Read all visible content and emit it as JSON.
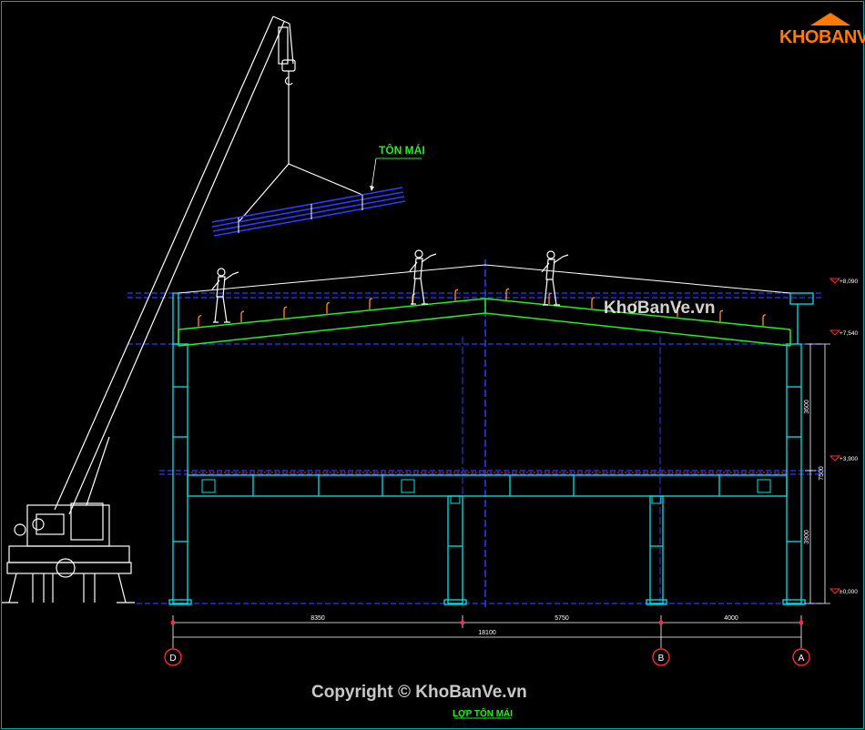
{
  "logo": {
    "brand": "KHOBANVE"
  },
  "watermark": "KhoBanVe.vn",
  "copyright": "Copyright © KhoBanVe.vn",
  "title": "LỢP TÔN MÁI",
  "callout_label": "TÔN MÁI",
  "levels": {
    "top": "+8,090",
    "eave": "+7,540",
    "mezzanine": "+3,900",
    "ground": "±0,000"
  },
  "vertical_dims": {
    "upper": "3600",
    "lower": "3900",
    "total": "7500"
  },
  "horizontal_dims": {
    "span_1": "8350",
    "span_2": "5750",
    "span_3": "4000",
    "total": "18100"
  },
  "grid_axes": {
    "left": "D",
    "mid": "B",
    "right": "A"
  },
  "colors": {
    "frame": "#00e5e5",
    "roof": "#22ee22",
    "deck": "#2a3cff",
    "figure": "#ffffff",
    "marker": "#ff2a2a",
    "accent": "#ff7a00"
  }
}
